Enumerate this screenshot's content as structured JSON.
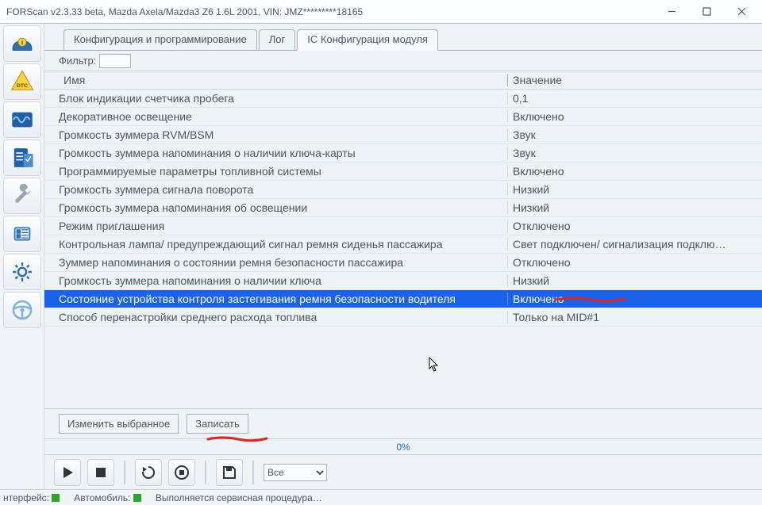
{
  "window": {
    "title": "FORScan v2.3.33 beta, Mazda Axela/Mazda3 Z6 1.6L 2001, VIN: JMZ*********18165"
  },
  "tabs": [
    {
      "label": "Конфигурация и программирование",
      "active": false
    },
    {
      "label": "Лог",
      "active": false
    },
    {
      "label": "IC Конфигурация модуля",
      "active": true
    }
  ],
  "filter": {
    "label": "Фильтр:",
    "value": ""
  },
  "columns": {
    "name": "Имя",
    "value": "Значение"
  },
  "rows": [
    {
      "name": "Блок индикации счетчика пробега",
      "value": "0,1"
    },
    {
      "name": "Декоративное освещение",
      "value": "Включено"
    },
    {
      "name": "Громкость зуммера RVM/BSM",
      "value": "Звук"
    },
    {
      "name": "Громкость зуммера напоминания о наличии ключа-карты",
      "value": "Звук"
    },
    {
      "name": "Программируемые параметры топливной системы",
      "value": "Включено"
    },
    {
      "name": "Громкость зуммера сигнала поворота",
      "value": "Низкий"
    },
    {
      "name": "Громкость зуммера напоминания об освещении",
      "value": "Низкий"
    },
    {
      "name": "Режим приглашения",
      "value": "Отключено"
    },
    {
      "name": "Контрольная лампа/ предупреждающий сигнал ремня сиденья пассажира",
      "value": "Свет подключен/ сигнализация подклю…"
    },
    {
      "name": "Зуммер напоминания о состоянии ремня безопасности пассажира",
      "value": "Отключено"
    },
    {
      "name": "Громкость зуммера напоминания о наличии ключа",
      "value": "Низкий"
    },
    {
      "name": "Состояние устройства контроля застегивания ремня безопасности водителя",
      "value": "Включено",
      "selected": true
    },
    {
      "name": "Способ перенастройки среднего расхода топлива",
      "value": "Только на MID#1"
    }
  ],
  "buttons": {
    "edit_selected": "Изменить выбранное",
    "write": "Записать"
  },
  "progress": {
    "text": "0%"
  },
  "toolbar": {
    "combo_value": "Все"
  },
  "status": {
    "interface": "нтерфейс:",
    "car": "Автомобиль:",
    "service": "Выполняется сервисная процедура…"
  }
}
